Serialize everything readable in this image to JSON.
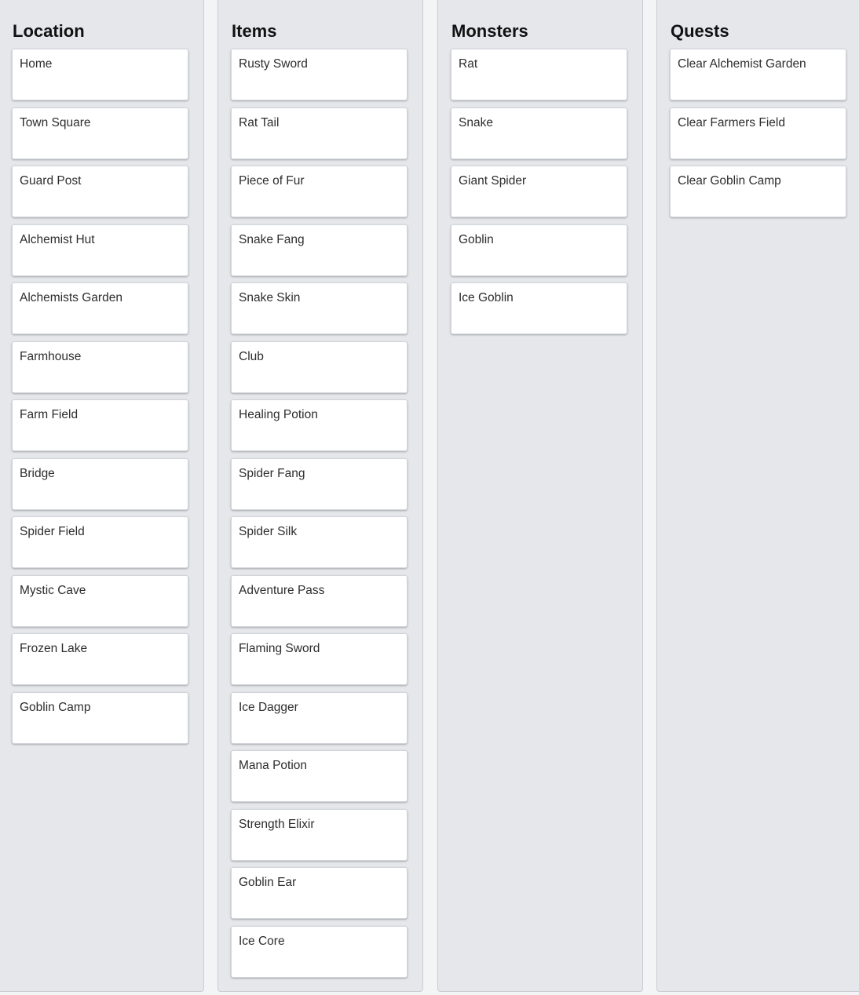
{
  "columns": [
    {
      "title": "Location",
      "cards": [
        "Home",
        "Town Square",
        "Guard Post",
        "Alchemist Hut",
        "Alchemists Garden",
        "Farmhouse",
        "Farm Field",
        "Bridge",
        "Spider Field",
        "Mystic Cave",
        "Frozen Lake",
        "Goblin Camp"
      ]
    },
    {
      "title": "Items",
      "cards": [
        "Rusty Sword",
        "Rat Tail",
        "Piece of Fur",
        "Snake Fang",
        "Snake Skin",
        "Club",
        "Healing Potion",
        "Spider Fang",
        "Spider Silk",
        "Adventure Pass",
        "Flaming Sword",
        "Ice Dagger",
        "Mana Potion",
        "Strength Elixir",
        "Goblin Ear",
        "Ice Core"
      ]
    },
    {
      "title": "Monsters",
      "cards": [
        "Rat",
        "Snake",
        "Giant Spider",
        "Goblin",
        "Ice Goblin"
      ]
    },
    {
      "title": "Quests",
      "cards": [
        "Clear Alchemist Garden",
        "Clear Farmers Field",
        "Clear Goblin Camp"
      ]
    }
  ]
}
